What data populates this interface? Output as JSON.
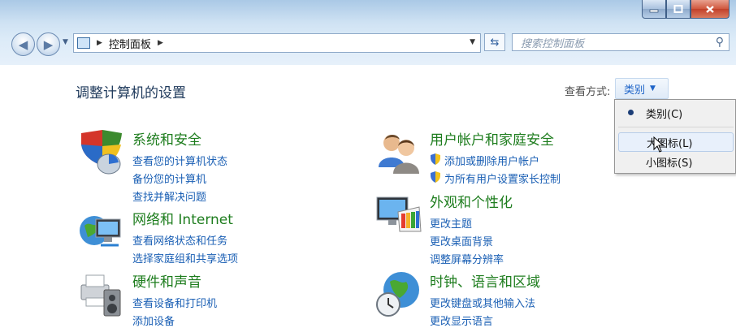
{
  "address_bar": {
    "breadcrumb": [
      "控制面板"
    ],
    "search_placeholder": "搜索控制面板"
  },
  "page": {
    "title": "调整计算机的设置",
    "view_by_label": "查看方式:",
    "view_by_value": "类别"
  },
  "view_menu": {
    "items": [
      {
        "label": "类别(C)",
        "selected": true
      },
      {
        "label": "大图标(L)",
        "selected": false,
        "hovered": true
      },
      {
        "label": "小图标(S)",
        "selected": false
      }
    ]
  },
  "categories": [
    {
      "title": "系统和安全",
      "icon": "shield-icon",
      "links": [
        "查看您的计算机状态",
        "备份您的计算机",
        "查找并解决问题"
      ]
    },
    {
      "title": "网络和 Internet",
      "icon": "network-globe-icon",
      "links": [
        "查看网络状态和任务",
        "选择家庭组和共享选项"
      ]
    },
    {
      "title": "硬件和声音",
      "icon": "printer-speaker-icon",
      "links": [
        "查看设备和打印机",
        "添加设备"
      ]
    },
    {
      "title": "用户帐户和家庭安全",
      "icon": "users-icon",
      "links": [
        "添加或删除用户帐户",
        "为所有用户设置家长控制"
      ]
    },
    {
      "title": "外观和个性化",
      "icon": "monitor-palette-icon",
      "links": [
        "更改主题",
        "更改桌面背景",
        "调整屏幕分辨率"
      ]
    },
    {
      "title": "时钟、语言和区域",
      "icon": "globe-clock-icon",
      "links": [
        "更改键盘或其他输入法",
        "更改显示语言"
      ]
    }
  ],
  "colors": {
    "category_title": "#1e7d1e",
    "link": "#1a5fb4",
    "page_title": "#1e395b"
  }
}
